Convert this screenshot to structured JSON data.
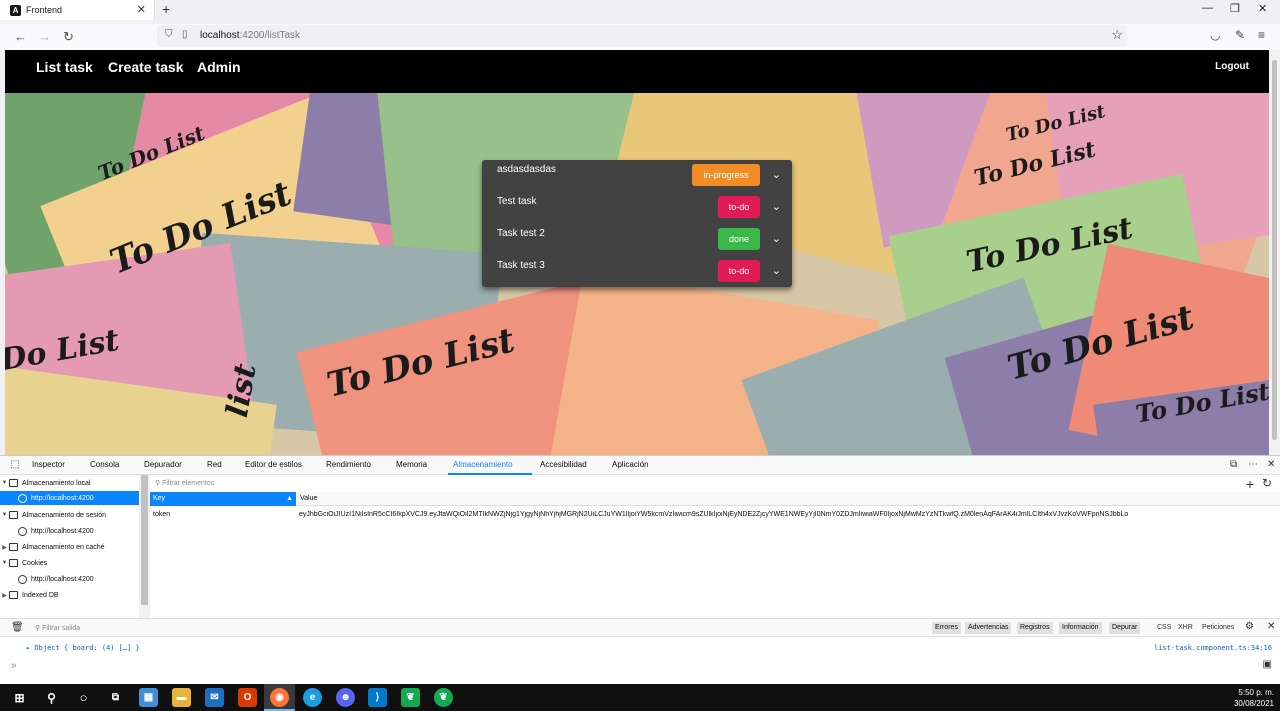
{
  "browser": {
    "tab_title": "Frontend",
    "tab_icon": "angular-icon",
    "url_host": "localhost",
    "url_path": ":4200/listTask"
  },
  "app": {
    "menu": [
      "List task",
      "Create task",
      "Admin"
    ],
    "logout": "Logout",
    "background_texts": [
      "To Do List",
      "To Do List",
      "To Do List",
      "To Do List",
      "Do List",
      "To Do List",
      "list",
      "To Do List",
      "To Do List",
      "To Do List"
    ]
  },
  "tasks": [
    {
      "name": "asdasdasdas",
      "status": "in-progress",
      "color": "#f28d26"
    },
    {
      "name": "Test task",
      "status": "to-do",
      "color": "#e01b55"
    },
    {
      "name": "Task test 2",
      "status": "done",
      "color": "#3bb84a"
    },
    {
      "name": "Task test 3",
      "status": "to-do",
      "color": "#e01b55"
    }
  ],
  "devtools": {
    "tabs": [
      "Inspector",
      "Consola",
      "Depurador",
      "Red",
      "Editor de estilos",
      "Rendimiento",
      "Memoria",
      "Almacenamiento",
      "Accesibilidad",
      "Aplicación"
    ],
    "active_tab": "Almacenamiento",
    "sidebar": [
      {
        "label": "Almacenamiento local",
        "kind": "group"
      },
      {
        "label": "http://localhost:4200",
        "kind": "origin",
        "selected": true
      },
      {
        "label": "Almacenamiento de sesión",
        "kind": "group"
      },
      {
        "label": "http://localhost:4200",
        "kind": "origin"
      },
      {
        "label": "Almacenamiento en caché",
        "kind": "group-collapsed"
      },
      {
        "label": "Cookies",
        "kind": "group"
      },
      {
        "label": "http://localhost:4200",
        "kind": "origin"
      },
      {
        "label": "Indexed DB",
        "kind": "group-collapsed"
      }
    ],
    "filter_placeholder": "Filtrar elementos",
    "table": {
      "headers": [
        "Key",
        "Value"
      ],
      "rows": [
        {
          "key": "token",
          "value": "eyJhbGciOiJIUzI1NiIsInR5cCI6IkpXVCJ9.eyJfaWQiOiI2MTIkNWZjNjg1YjgyNjNhYjhjMGRjN2UiLCJuYW1lIjoiYW5kcmVzIiwicm9sZUlkIjoiNjEyNDE2ZjcyYWE1NWEyYjI0NmY0ZDJmIiwiaWF0IjoxNjMwMzYzNTkwfQ.zM0lenAqFArAK4iJmlLCIth4xVJvzKoVWFpnNSJbbLo"
        }
      ]
    },
    "console": {
      "filter_placeholder": "Filtrar salida",
      "chips": [
        "Errores",
        "Advertencias",
        "Registros",
        "Información",
        "Depurar"
      ],
      "right": [
        "CSS",
        "XHR",
        "Peticiones"
      ],
      "log": "▸ Object { board: (4) […] }",
      "log_source": "list-task.component.ts:34:16",
      "prompt": "»"
    }
  },
  "taskbar": {
    "time": "5:50 p. m.",
    "date": "30/08/2021"
  }
}
